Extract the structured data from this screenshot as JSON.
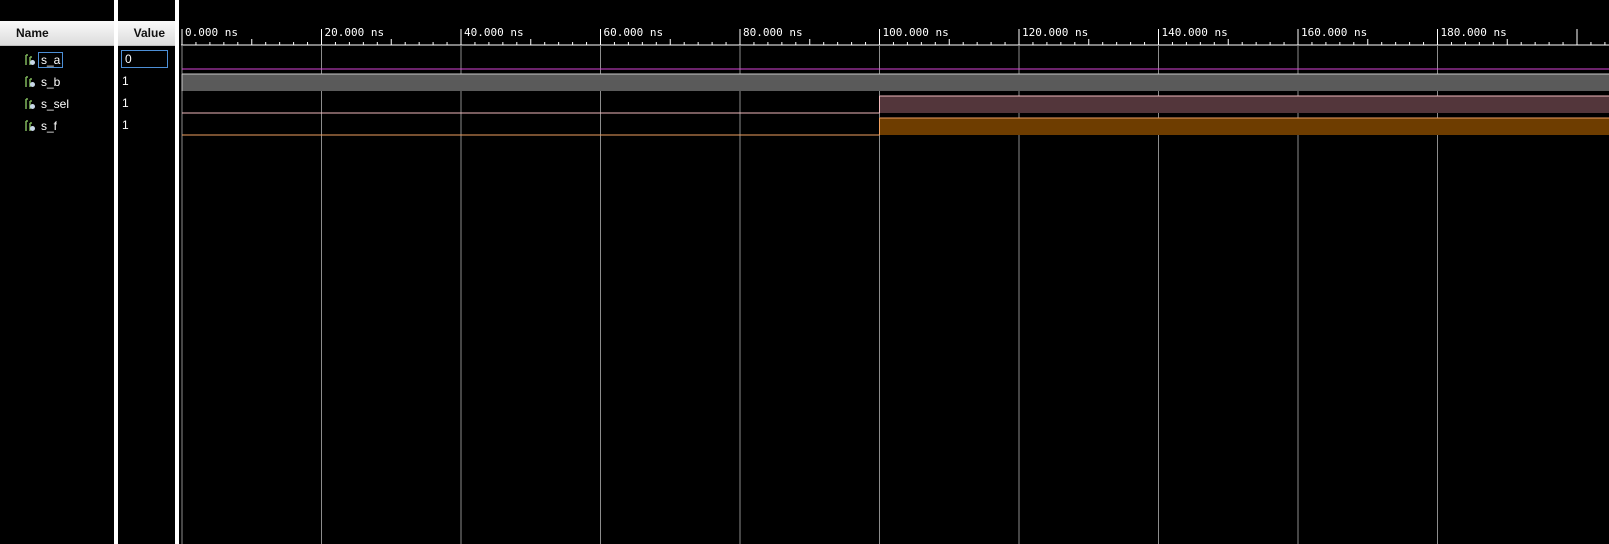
{
  "columns": {
    "name_header": "Name",
    "value_header": "Value"
  },
  "signals": [
    {
      "name": "s_a",
      "value": "0",
      "icon": "logic-signal-icon",
      "selected": true
    },
    {
      "name": "s_b",
      "value": "1",
      "icon": "logic-signal-icon",
      "selected": false
    },
    {
      "name": "s_sel",
      "value": "1",
      "icon": "logic-signal-icon",
      "selected": false
    },
    {
      "name": "s_f",
      "value": "1",
      "icon": "logic-signal-icon",
      "selected": false
    }
  ],
  "timeline": {
    "unit": "ns",
    "tick_labels": [
      "0.000 ns",
      "20.000 ns",
      "40.000 ns",
      "60.000 ns",
      "80.000 ns",
      "100.000 ns",
      "120.000 ns",
      "140.000 ns",
      "160.000 ns",
      "180.000 ns"
    ],
    "major_step_ns": 20,
    "minor_step_ns": 2,
    "visible_range_ns": [
      0,
      198
    ]
  },
  "waveforms": [
    {
      "signal": "s_a",
      "transitions": [
        [
          0,
          0
        ]
      ],
      "color": "#d946d9"
    },
    {
      "signal": "s_b",
      "transitions": [
        [
          0,
          1
        ]
      ],
      "color": "#c9c9c9",
      "fill": "#5a5a5a"
    },
    {
      "signal": "s_sel",
      "transitions": [
        [
          0,
          0
        ],
        [
          100,
          1
        ]
      ],
      "color": "#f0b9bd",
      "fill": "#53363b"
    },
    {
      "signal": "s_f",
      "transitions": [
        [
          0,
          0
        ],
        [
          100,
          1
        ]
      ],
      "color": "#f0a060",
      "fill": "#6e3d00"
    }
  ],
  "colors": {
    "background": "#000000",
    "grid": "#8c8c8c",
    "ruler": "#ffffff",
    "selection": "#4d8fd6"
  }
}
